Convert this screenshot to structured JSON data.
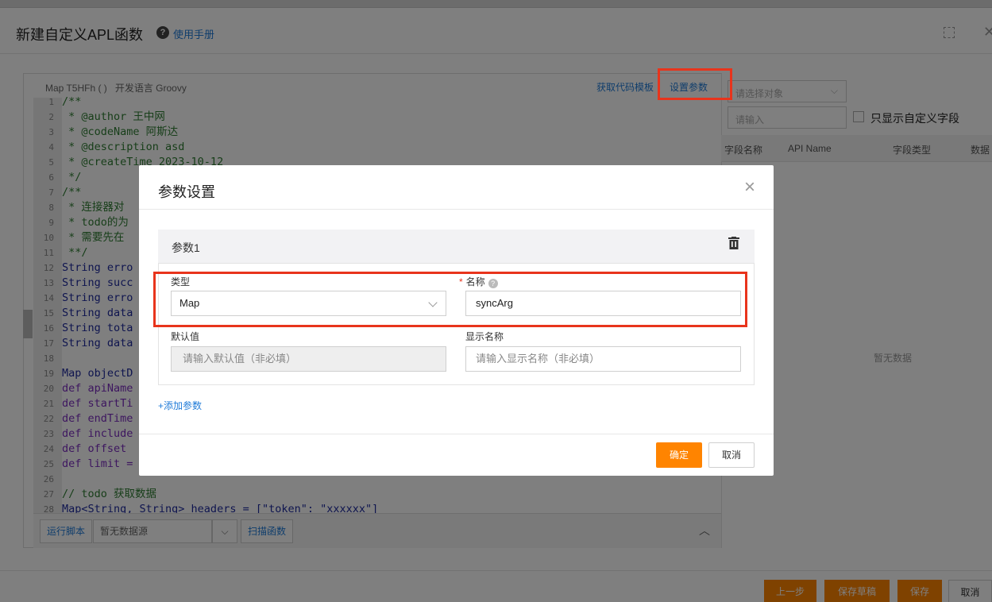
{
  "header": {
    "title": "新建自定义APL函数",
    "help_icon": "?",
    "manual_link": "使用手册"
  },
  "editor": {
    "signature": "Map T5HFh ( )",
    "language_label": "开发语言 Groovy",
    "get_template_link": "获取代码模板",
    "set_params_link": "设置参数",
    "lines": [
      {
        "n": "1",
        "text": "/**",
        "cls": "cm"
      },
      {
        "n": "2",
        "text": " * @author 王中网",
        "cls": "cm"
      },
      {
        "n": "3",
        "text": " * @codeName 阿斯达",
        "cls": "cm"
      },
      {
        "n": "4",
        "text": " * @description asd",
        "cls": "cm"
      },
      {
        "n": "5",
        "text": " * @createTime 2023-10-12",
        "cls": "cm"
      },
      {
        "n": "6",
        "text": " */",
        "cls": "cm"
      },
      {
        "n": "7",
        "text": "/**",
        "cls": "cm"
      },
      {
        "n": "8",
        "text": " * 连接器对",
        "cls": "cm"
      },
      {
        "n": "9",
        "text": " * todo的为",
        "cls": "cm"
      },
      {
        "n": "10",
        "text": " * 需要先在",
        "cls": "cm"
      },
      {
        "n": "11",
        "text": " **/",
        "cls": "cm"
      },
      {
        "n": "12",
        "text": "String erro",
        "cls": ""
      },
      {
        "n": "13",
        "text": "String succ",
        "cls": ""
      },
      {
        "n": "14",
        "text": "String erro",
        "cls": ""
      },
      {
        "n": "15",
        "text": "String data",
        "cls": ""
      },
      {
        "n": "16",
        "text": "String tota",
        "cls": ""
      },
      {
        "n": "17",
        "text": "String data",
        "cls": ""
      },
      {
        "n": "18",
        "text": "",
        "cls": ""
      },
      {
        "n": "19",
        "text": "Map objectD",
        "cls": ""
      },
      {
        "n": "20",
        "text": "def apiName",
        "cls": "kw"
      },
      {
        "n": "21",
        "text": "def startTi",
        "cls": "kw"
      },
      {
        "n": "22",
        "text": "def endTime",
        "cls": "kw"
      },
      {
        "n": "23",
        "text": "def include",
        "cls": "kw"
      },
      {
        "n": "24",
        "text": "def offset ",
        "cls": "kw"
      },
      {
        "n": "25",
        "text": "def limit =",
        "cls": "kw"
      },
      {
        "n": "26",
        "text": "",
        "cls": ""
      },
      {
        "n": "27",
        "text": "// todo 获取数据",
        "cls": "cm"
      },
      {
        "n": "28",
        "text": "Map<String, String> headers = [\"token\": \"xxxxxx\"]",
        "cls": ""
      }
    ],
    "run_button": "运行脚本",
    "datasource_value": "暂无数据源",
    "scan_button": "扫描函数"
  },
  "right_panel": {
    "object_placeholder": "请选择对象",
    "search_placeholder": "请输入",
    "only_custom_label": "只显示自定义字段",
    "columns": [
      "字段名称",
      "API Name",
      "字段类型",
      "数据"
    ],
    "empty_text": "暂无数据"
  },
  "footer": {
    "prev_button": "上一步",
    "save_draft_button": "保存草稿",
    "save_button": "保存",
    "cancel_button": "取消"
  },
  "modal": {
    "title": "参数设置",
    "param_title": "参数1",
    "type_label": "类型",
    "type_value": "Map",
    "name_label": "名称",
    "name_value": "syncArg",
    "default_label": "默认值",
    "default_placeholder": "请输入默认值（非必填）",
    "display_label": "显示名称",
    "display_placeholder": "请输入显示名称（非必填）",
    "add_param_link": "+添加参数",
    "ok_button": "确定",
    "cancel_button": "取消"
  },
  "colors": {
    "accent_link": "#1f7bd8",
    "primary_button": "#ff8400",
    "highlight_box": "#e8341c"
  }
}
